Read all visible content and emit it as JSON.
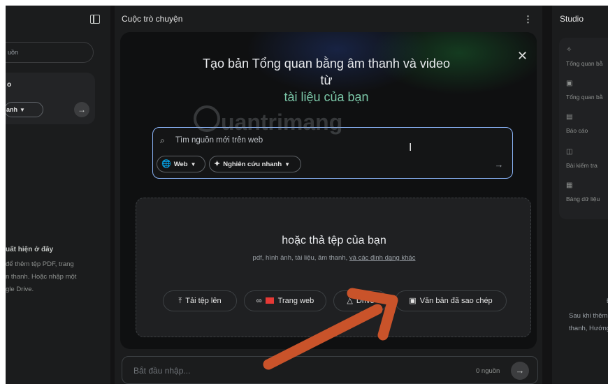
{
  "left_panel": {
    "search_hint": "uồn",
    "card_letter": "o",
    "chip_label": "anh",
    "empty_title": "uất hiện ở đây",
    "empty_desc": "để thêm tệp PDF, trang\nn thanh. Hoặc nhập một\ngle Drive."
  },
  "center": {
    "header": "Cuộc trò chuyện",
    "modal": {
      "title_line1": "Tạo bản Tổng quan bằng âm thanh và video",
      "title_line2": "từ",
      "subtitle": "tài liệu của bạn",
      "search_placeholder": "Tìm nguồn mới trên web",
      "pill_web": "Web",
      "pill_research": "Nghiên cứu nhanh",
      "drop_title": "hoặc thả tệp của bạn",
      "drop_sub": "pdf, hình ảnh, tài liệu, âm thanh,",
      "drop_link": "và các định dạng khác",
      "btn_upload": "Tải tệp lên",
      "btn_web": "Trang web",
      "btn_drive": "Drive",
      "btn_copied": "Văn bản đã sao chép"
    },
    "composer": {
      "placeholder": "Bắt đầu nhập...",
      "count": "0 nguồn"
    }
  },
  "right_panel": {
    "header": "Studio",
    "tools": [
      {
        "label": "Tổng quan bằ",
        "icon": "audio-overview-icon"
      },
      {
        "label": "Tổng quan bằ",
        "icon": "video-overview-icon"
      },
      {
        "label": "Báo cáo",
        "icon": "report-icon"
      },
      {
        "label": "Bài kiểm tra",
        "icon": "quiz-icon"
      },
      {
        "label": "Bảng dữ liệu",
        "icon": "data-table-icon"
      }
    ],
    "empty_title": "Đầ",
    "empty_desc": "Sau khi thêm\nthanh, Hướng"
  },
  "watermark": "uantrimang",
  "colors": {
    "background": "#131314",
    "panel": "#1b1c1d",
    "accent_border": "#8ab4f8",
    "subtitle_green": "#7bc7a8",
    "annotation_arrow": "#c9532a"
  }
}
